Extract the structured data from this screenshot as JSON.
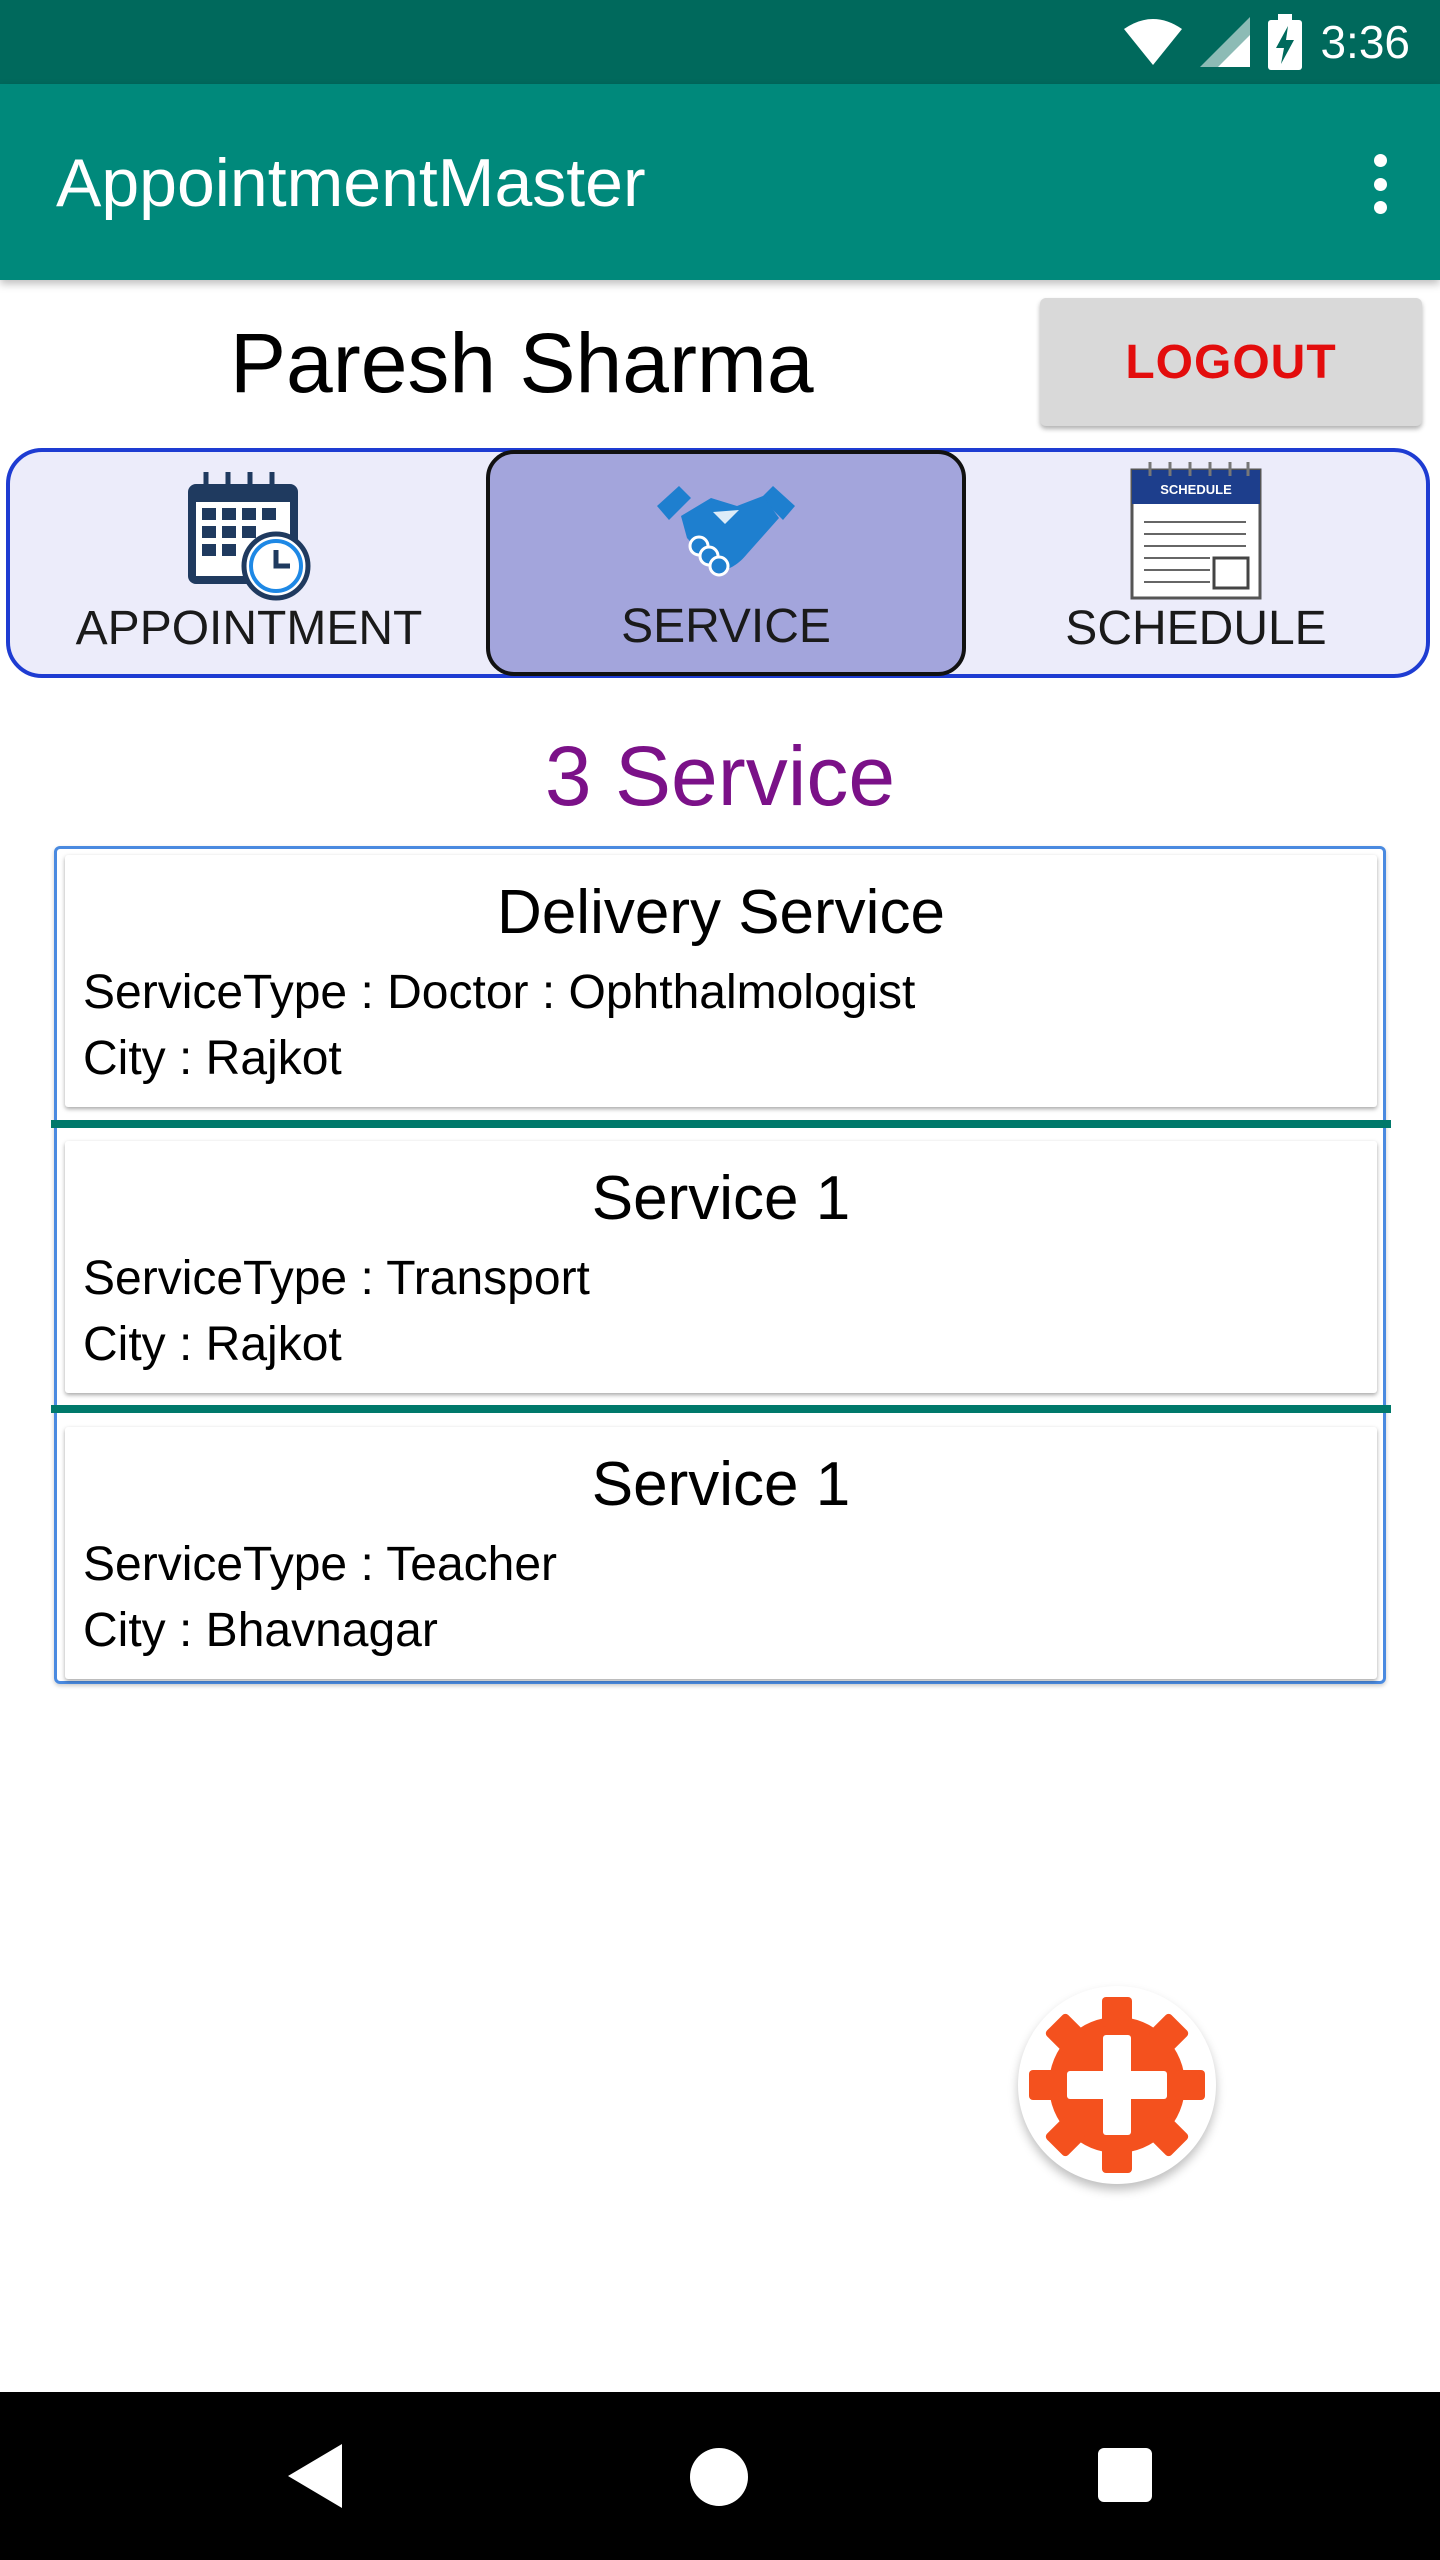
{
  "status_bar": {
    "time": "3:36",
    "icons": [
      "wifi-icon",
      "signal-icon",
      "battery-charging-icon"
    ]
  },
  "app_bar": {
    "title": "AppointmentMaster",
    "menu_icon": "more-vert-icon"
  },
  "user": {
    "name": "Paresh Sharma",
    "logout_label": "LOGOUT"
  },
  "tabs": [
    {
      "label": "APPOINTMENT",
      "icon": "calendar-clock-icon",
      "selected": false
    },
    {
      "label": "SERVICE",
      "icon": "handshake-icon",
      "selected": true
    },
    {
      "label": "SCHEDULE",
      "icon": "schedule-document-icon",
      "selected": false,
      "icon_text": "SCHEDULE"
    }
  ],
  "section_title": "3 Service",
  "services": [
    {
      "title": "Delivery Service",
      "type": "ServiceType : Doctor : Ophthalmologist",
      "city": "City : Rajkot"
    },
    {
      "title": "Service 1",
      "type": "ServiceType : Transport",
      "city": "City : Rajkot"
    },
    {
      "title": "Service 1",
      "type": "ServiceType : Teacher",
      "city": "City : Bhavnagar"
    }
  ],
  "fab": {
    "icon": "add-service-gear-icon"
  },
  "nav": {
    "back_icon": "back-icon",
    "home_icon": "home-icon",
    "recents_icon": "recents-icon"
  },
  "colors": {
    "status_bar": "#00695c",
    "app_bar": "#00897b",
    "logout_text": "#e30d0d",
    "section_title": "#7b1188",
    "selected_tab": "#a3a5dc",
    "divider": "#00796b",
    "fab_gear": "#f4511e"
  }
}
